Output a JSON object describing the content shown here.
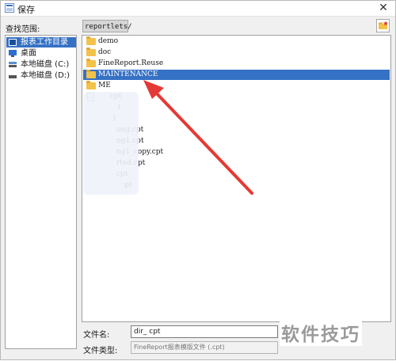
{
  "window": {
    "title": "保存",
    "close_glyph": "✕"
  },
  "scope": {
    "label": "查找范围:",
    "path": "reportlets/"
  },
  "places": [
    {
      "label": "报表工作目录",
      "icon": "report-dir-icon",
      "selected": true
    },
    {
      "label": "桌面",
      "icon": "desktop-icon",
      "selected": false
    },
    {
      "label": "本地磁盘 (C:)",
      "icon": "drive-icon",
      "selected": false
    },
    {
      "label": "本地磁盘 (D:)",
      "icon": "drive-icon",
      "selected": false
    }
  ],
  "files": [
    {
      "name": "demo",
      "type": "folder",
      "selected": false
    },
    {
      "name": "doc",
      "type": "folder",
      "selected": false
    },
    {
      "name": "FineReport.Reuse",
      "type": "folder",
      "selected": false
    },
    {
      "name": "MAINTENANCE",
      "type": "folder",
      "selected": true
    },
    {
      "name": "ME",
      "type": "folder",
      "selected": false
    },
    {
      "name": "cpt",
      "type": "file",
      "selected": false
    },
    {
      "name": "t",
      "type": "file",
      "selected": false
    },
    {
      "name": "t",
      "type": "file",
      "selected": false
    },
    {
      "name": "ong.cpt",
      "type": "file",
      "selected": false
    },
    {
      "name": "ng1.cpt",
      "type": "file",
      "selected": false
    },
    {
      "name": "ng1_copy.cpt",
      "type": "file",
      "selected": false
    },
    {
      "name": "rted.cpt",
      "type": "file",
      "selected": false
    },
    {
      "name": "cpt",
      "type": "file",
      "selected": false
    },
    {
      "name": "pt",
      "type": "file",
      "selected": false
    }
  ],
  "filename": {
    "label": "文件名:",
    "value": "dir_        cpt"
  },
  "filetype": {
    "label": "文件类型:",
    "value": "FineReport报表模版文件 (.cpt)"
  },
  "watermark": "软件技巧",
  "colors": {
    "selection": "#3571c4",
    "folder": "#f3c24b",
    "arrow": "#e53935"
  }
}
